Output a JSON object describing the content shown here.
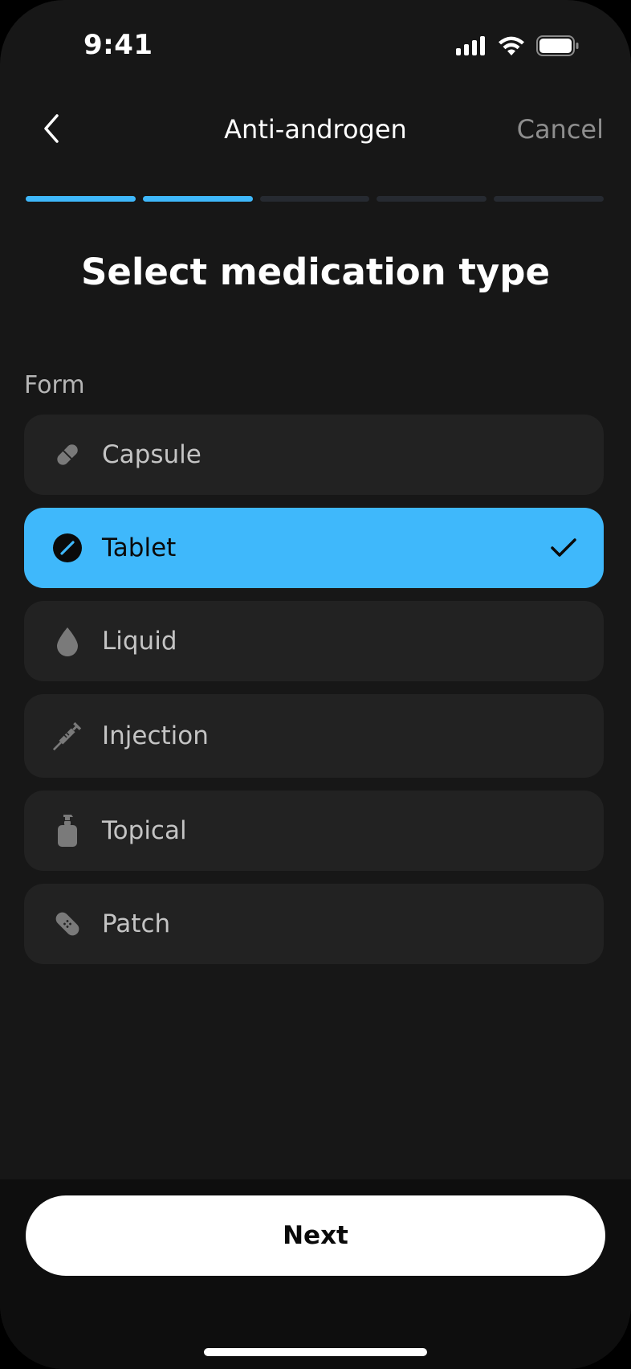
{
  "status_bar": {
    "time": "9:41",
    "icons": [
      "cellular-signal-icon",
      "wifi-icon",
      "battery-icon"
    ]
  },
  "nav": {
    "back_icon": "chevron-left-icon",
    "title": "Anti-androgen",
    "cancel_label": "Cancel"
  },
  "progress": {
    "total_steps": 5,
    "completed_steps": 2,
    "active_color": "#3fb8fb",
    "inactive_color": "#262a31"
  },
  "heading": "Select medication type",
  "form": {
    "label": "Form",
    "selected": "Tablet",
    "options": [
      {
        "label": "Capsule",
        "icon": "capsule-icon",
        "selected": false
      },
      {
        "label": "Tablet",
        "icon": "tablet-icon",
        "selected": true
      },
      {
        "label": "Liquid",
        "icon": "droplet-icon",
        "selected": false
      },
      {
        "label": "Injection",
        "icon": "syringe-icon",
        "selected": false
      },
      {
        "label": "Topical",
        "icon": "pump-bottle-icon",
        "selected": false
      },
      {
        "label": "Patch",
        "icon": "bandage-icon",
        "selected": false
      }
    ]
  },
  "colors": {
    "accent": "#3fb8fb",
    "background": "#171717",
    "card": "#222222"
  },
  "footer": {
    "next_label": "Next"
  }
}
